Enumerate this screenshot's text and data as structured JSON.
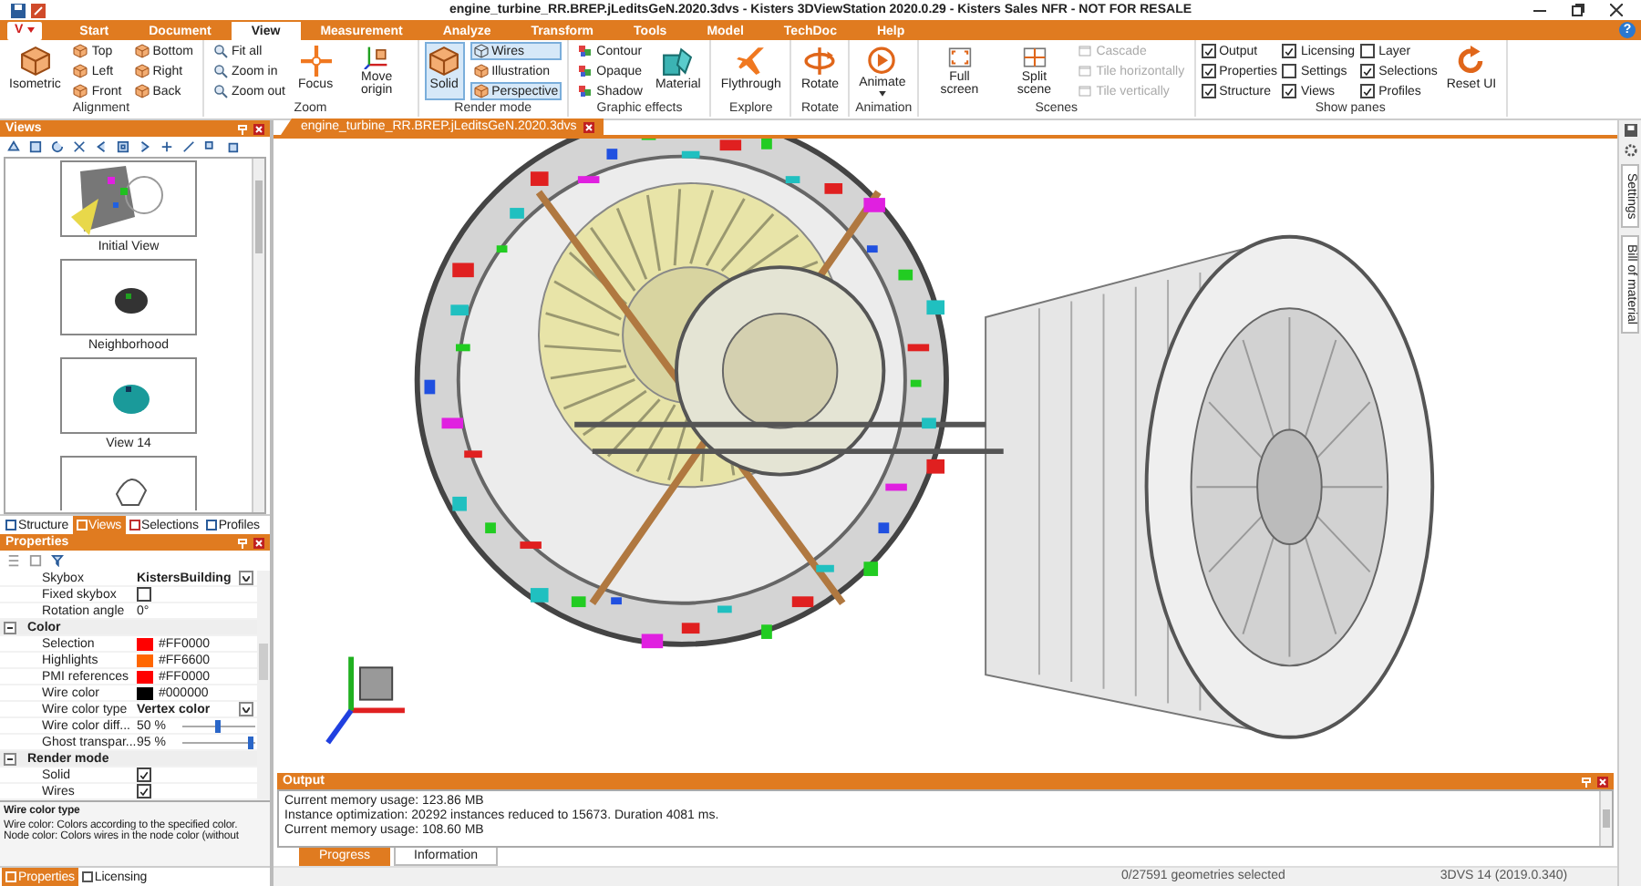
{
  "window": {
    "title": "engine_turbine_RR.BREP.jLeditsGeN.2020.3dvs - Kisters 3DViewStation 2020.0.29 - Kisters Sales NFR - NOT FOR RESALE"
  },
  "app_button": {
    "label": "V"
  },
  "menu_tabs": [
    {
      "label": "Start",
      "selected": false
    },
    {
      "label": "Document",
      "selected": false
    },
    {
      "label": "View",
      "selected": true
    },
    {
      "label": "Measurement",
      "selected": false
    },
    {
      "label": "Analyze",
      "selected": false
    },
    {
      "label": "Transform",
      "selected": false
    },
    {
      "label": "Tools",
      "selected": false
    },
    {
      "label": "Model",
      "selected": false
    },
    {
      "label": "TechDoc",
      "selected": false
    },
    {
      "label": "Help",
      "selected": false
    }
  ],
  "help_button": {
    "label": "?"
  },
  "ribbon": {
    "groups": [
      {
        "title": "Alignment",
        "items": [
          {
            "kind": "large",
            "label": "Isometric"
          },
          {
            "kind": "small",
            "label": "Top"
          },
          {
            "kind": "small",
            "label": "Left"
          },
          {
            "kind": "small",
            "label": "Front"
          },
          {
            "kind": "small",
            "label": "Bottom"
          },
          {
            "kind": "small",
            "label": "Right"
          },
          {
            "kind": "small",
            "label": "Back"
          }
        ]
      },
      {
        "title": "Zoom",
        "items": [
          {
            "kind": "small",
            "label": "Fit all"
          },
          {
            "kind": "small",
            "label": "Zoom in"
          },
          {
            "kind": "small",
            "label": "Zoom out"
          },
          {
            "kind": "large",
            "label": "Focus"
          },
          {
            "kind": "large",
            "label": "Move origin"
          }
        ]
      },
      {
        "title": "Render mode",
        "items": [
          {
            "kind": "large",
            "label": "Solid",
            "selected": true
          },
          {
            "kind": "small",
            "label": "Wires",
            "selected": true
          },
          {
            "kind": "small",
            "label": "Illustration",
            "selected": false
          },
          {
            "kind": "small",
            "label": "Perspective",
            "selected": true
          }
        ]
      },
      {
        "title": "Graphic effects",
        "items": [
          {
            "kind": "small",
            "label": "Contour"
          },
          {
            "kind": "small",
            "label": "Opaque"
          },
          {
            "kind": "small",
            "label": "Shadow"
          },
          {
            "kind": "large",
            "label": "Material"
          }
        ]
      },
      {
        "title": "Explore",
        "items": [
          {
            "kind": "large",
            "label": "Flythrough"
          }
        ]
      },
      {
        "title": "Rotate",
        "items": [
          {
            "kind": "large",
            "label": "Rotate"
          }
        ]
      },
      {
        "title": "Animation",
        "items": [
          {
            "kind": "large",
            "label": "Animate",
            "dropdown": true
          }
        ]
      },
      {
        "title": "Scenes",
        "items": [
          {
            "kind": "large",
            "label": "Full screen",
            "disabled": false
          },
          {
            "kind": "large",
            "label": "Split scene",
            "disabled": false
          },
          {
            "kind": "small",
            "label": "Cascade",
            "disabled": true
          },
          {
            "kind": "small",
            "label": "Tile horizontally",
            "disabled": true
          },
          {
            "kind": "small",
            "label": "Tile vertically",
            "disabled": true
          }
        ]
      },
      {
        "title": "Show panes",
        "items": [
          {
            "kind": "check",
            "label": "Output",
            "checked": true
          },
          {
            "kind": "check",
            "label": "Properties",
            "checked": true
          },
          {
            "kind": "check",
            "label": "Structure",
            "checked": true
          },
          {
            "kind": "check",
            "label": "Licensing",
            "checked": true
          },
          {
            "kind": "check",
            "label": "Settings",
            "checked": false
          },
          {
            "kind": "check",
            "label": "Views",
            "checked": true
          },
          {
            "kind": "check",
            "label": "Layer",
            "checked": false
          },
          {
            "kind": "check",
            "label": "Selections",
            "checked": true
          },
          {
            "kind": "check",
            "label": "Profiles",
            "checked": true
          },
          {
            "kind": "large",
            "label": "Reset UI"
          }
        ]
      }
    ]
  },
  "views_panel": {
    "title": "Views",
    "views": [
      {
        "kind": "view",
        "label": "Initial View"
      },
      {
        "kind": "view",
        "label": "Neighborhood"
      },
      {
        "kind": "view",
        "label": "View 14"
      },
      {
        "kind": "partial"
      }
    ],
    "tabs": [
      {
        "label": "Structure",
        "selected": false
      },
      {
        "label": "Views",
        "selected": true
      },
      {
        "label": "Selections",
        "selected": false
      },
      {
        "label": "Profiles",
        "selected": false
      }
    ]
  },
  "properties_panel": {
    "title": "Properties",
    "rows": [
      {
        "kind": "select",
        "label": "Skybox",
        "value": "KistersBuilding"
      },
      {
        "kind": "check",
        "label": "Fixed skybox",
        "checked": false
      },
      {
        "kind": "text",
        "label": "Rotation angle",
        "value": "0°"
      },
      {
        "kind": "section",
        "label": "Color",
        "expanded": true
      },
      {
        "kind": "color",
        "label": "Selection",
        "value": "#FF0000",
        "color": "#ff0000"
      },
      {
        "kind": "color",
        "label": "Highlights",
        "value": "#FF6600",
        "color": "#ff6600"
      },
      {
        "kind": "color",
        "label": "PMI references",
        "value": "#FF0000",
        "color": "#ff0000"
      },
      {
        "kind": "color",
        "label": "Wire color",
        "value": "#000000",
        "color": "#000000"
      },
      {
        "kind": "select",
        "label": "Wire color type",
        "value": "Vertex color"
      },
      {
        "kind": "slider",
        "label": "Wire color diff...",
        "value": "50 %",
        "level": 0.5
      },
      {
        "kind": "slider",
        "label": "Ghost transpar...",
        "value": "95 %",
        "level": 0.95
      },
      {
        "kind": "section",
        "label": "Render mode",
        "expanded": true
      },
      {
        "kind": "check",
        "label": "Solid",
        "checked": true
      },
      {
        "kind": "check",
        "label": "Wires",
        "checked": true
      }
    ],
    "description": {
      "title": "Wire color type",
      "lines": [
        "Wire color: Colors according to the specified color.",
        "Node color: Colors wires in the node color (without"
      ]
    },
    "tabs": [
      {
        "label": "Properties",
        "selected": true
      },
      {
        "label": "Licensing",
        "selected": false
      }
    ]
  },
  "document_tab": {
    "title": "engine_turbine_RR.BREP.jLeditsGeN.2020.3dvs"
  },
  "output_panel": {
    "title": "Output",
    "lines": [
      "Current memory usage: 123.86 MB",
      "Instance optimization: 20292 instances reduced to 15673. Duration 4081 ms.",
      "Current memory usage: 108.60 MB"
    ],
    "tabs": [
      {
        "label": "Progress",
        "selected": true
      },
      {
        "label": "Information",
        "selected": false
      }
    ]
  },
  "status_bar": {
    "selection": "0/27591 geometries selected",
    "version": "3DVS 14 (2019.0.340)"
  },
  "side_tabs": [
    {
      "label": "Settings"
    },
    {
      "label": "Bill of material"
    }
  ]
}
